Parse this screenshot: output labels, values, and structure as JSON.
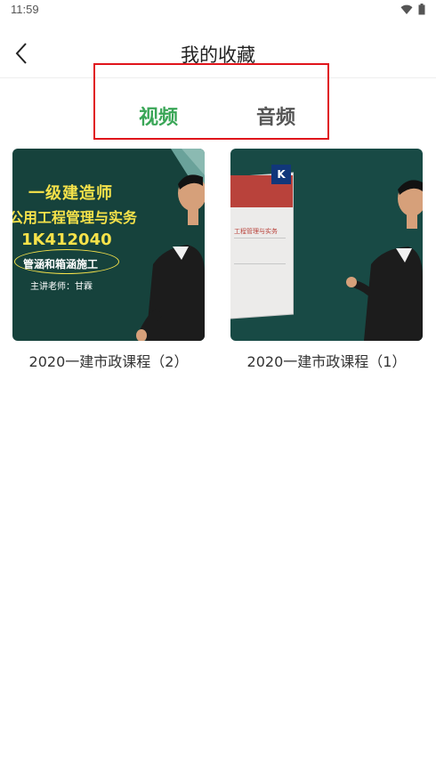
{
  "status_bar": {
    "time": "11:59",
    "icons": [
      "wifi-icon",
      "battery-icon"
    ]
  },
  "header": {
    "title": "我的收藏",
    "back_icon": "back-arrow-icon"
  },
  "tabs": {
    "video_label": "视频",
    "audio_label": "音频",
    "active": "视频"
  },
  "colors": {
    "active_tab": "#3aa657",
    "inactive_tab": "#555555",
    "highlight_box": "#e0141b"
  },
  "videos": [
    {
      "title": "2020一建市政课程（2）",
      "thumbnail_text": {
        "line1": "一级建造师",
        "line2": "公用工程管理与实务",
        "line3": "1K412040",
        "line4": "管涵和箱涵施工",
        "line5": "主讲老师：甘霖"
      }
    },
    {
      "title": "2020一建市政课程（1）",
      "thumbnail_text": {
        "book_letter": "K",
        "book_title": "工程管理与实务"
      }
    }
  ]
}
